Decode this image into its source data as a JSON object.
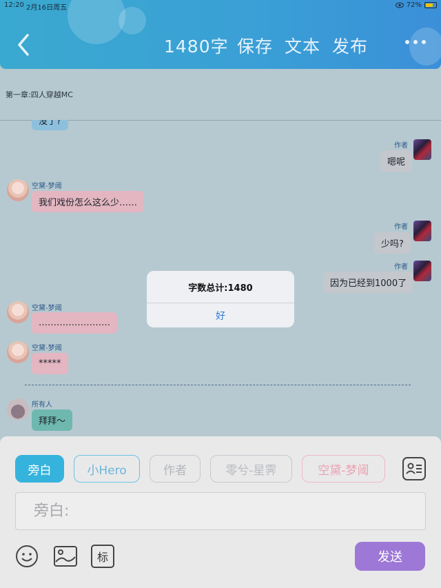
{
  "status": {
    "time": "12:20",
    "date": "2月16日周五",
    "battery": "72%",
    "battery_level": 0.72
  },
  "header": {
    "word_count": "1480字",
    "save": "保存",
    "text": "文本",
    "publish": "发布"
  },
  "chapter": {
    "title": "第一章:四人穿越MC"
  },
  "messages": [
    {
      "name": "",
      "text": "没了?"
    },
    {
      "name": "作者",
      "text": "嗯呢"
    },
    {
      "name": "空黛-梦阈",
      "text": "我们戏份怎么这么少……"
    },
    {
      "name": "作者",
      "text": "少吗?"
    },
    {
      "name": "作者",
      "text": "因为已经到1000了"
    },
    {
      "name": "空黛-梦阈",
      "text": "……………………"
    },
    {
      "name": "空黛-梦阈",
      "text": "*****"
    },
    {
      "name": "所有人",
      "text": "拜拜～"
    }
  ],
  "dialog": {
    "title": "字数总计:1480",
    "ok": "好"
  },
  "roles": [
    {
      "label": "旁白"
    },
    {
      "label": "小Hero"
    },
    {
      "label": "作者"
    },
    {
      "label": "零兮-星霁"
    },
    {
      "label": "空黛-梦阈"
    }
  ],
  "input": {
    "placeholder": "旁白:"
  },
  "toolbar": {
    "mark": "标",
    "send": "发送"
  },
  "colors": {
    "header": "#3aa9cf",
    "send": "#9d78d6",
    "active_role": "#36b3dc",
    "dialog_button": "#2e7bd6"
  },
  "icons": [
    "back-chevron-icon",
    "more-icon",
    "contact-card-icon",
    "emoji-icon",
    "image-icon"
  ]
}
